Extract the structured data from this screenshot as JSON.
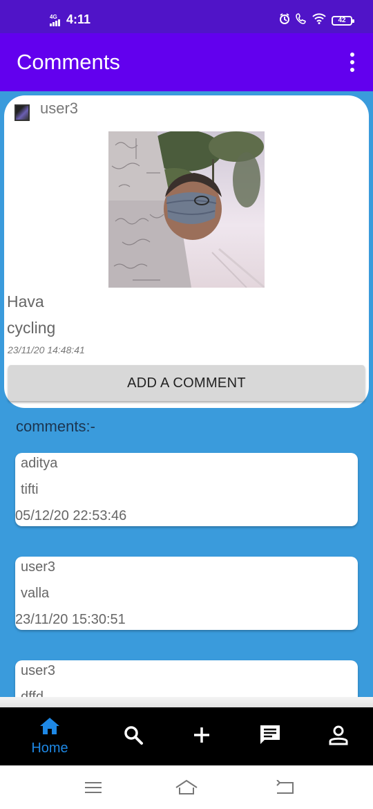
{
  "status_bar": {
    "network": "4G",
    "time": "4:11",
    "battery": "42",
    "icons": [
      "signal-icon",
      "alarm-icon",
      "call-icon",
      "wifi-icon",
      "battery-icon"
    ]
  },
  "app_bar": {
    "title": "Comments",
    "menu_icon": "more-vert-icon"
  },
  "post": {
    "username": "user3",
    "title": "Hava",
    "description": "cycling",
    "timestamp": "23/11/20 14:48:41",
    "add_comment_label": "ADD A COMMENT"
  },
  "comments_heading": "comments:-",
  "comments": [
    {
      "user": "aditya",
      "text": "tifti",
      "time": "05/12/20 22:53:46"
    },
    {
      "user": "user3",
      "text": "valla",
      "time": "23/11/20 15:30:51"
    },
    {
      "user": "user3",
      "text": "dffd",
      "time": ""
    }
  ],
  "bottom_nav": {
    "items": [
      {
        "label": "Home",
        "icon": "home-icon",
        "active": true
      },
      {
        "label": "",
        "icon": "search-icon",
        "active": false
      },
      {
        "label": "",
        "icon": "add-icon",
        "active": false
      },
      {
        "label": "",
        "icon": "chat-icon",
        "active": false
      },
      {
        "label": "",
        "icon": "profile-icon",
        "active": false
      }
    ]
  },
  "colors": {
    "status_bar": "#5014c8",
    "app_bar": "#6200ee",
    "background": "#3a9bdc",
    "active_nav": "#1e88e5"
  }
}
